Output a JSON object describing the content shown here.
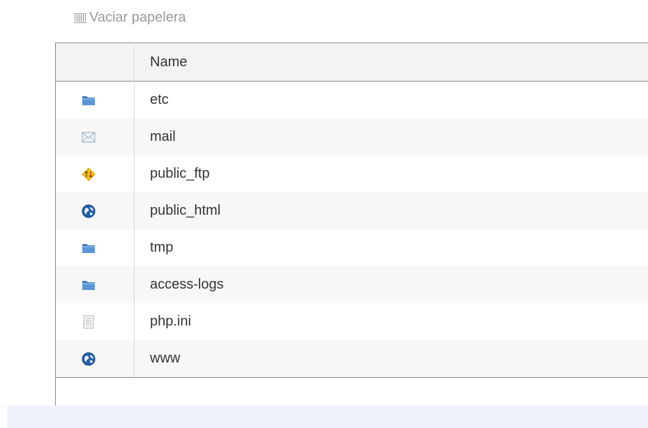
{
  "toolbar": {
    "empty_trash_label": "Vaciar papelera",
    "empty_trash_icon": "trash-icon"
  },
  "table": {
    "header": {
      "icon_column": "",
      "name_column": "Name"
    },
    "rows": [
      {
        "name": "etc",
        "icon": "folder-icon"
      },
      {
        "name": "mail",
        "icon": "mail-icon"
      },
      {
        "name": "public_ftp",
        "icon": "ftp-icon"
      },
      {
        "name": "public_html",
        "icon": "globe-icon"
      },
      {
        "name": "tmp",
        "icon": "folder-icon"
      },
      {
        "name": "access-logs",
        "icon": "folder-icon"
      },
      {
        "name": "php.ini",
        "icon": "document-icon"
      },
      {
        "name": "www",
        "icon": "globe-icon"
      }
    ]
  },
  "colors": {
    "folder": "#4a86c8",
    "header_bg": "#f3f3f3",
    "stripe_bg": "#f7f7f7",
    "footer_bg": "#eef3fb"
  }
}
